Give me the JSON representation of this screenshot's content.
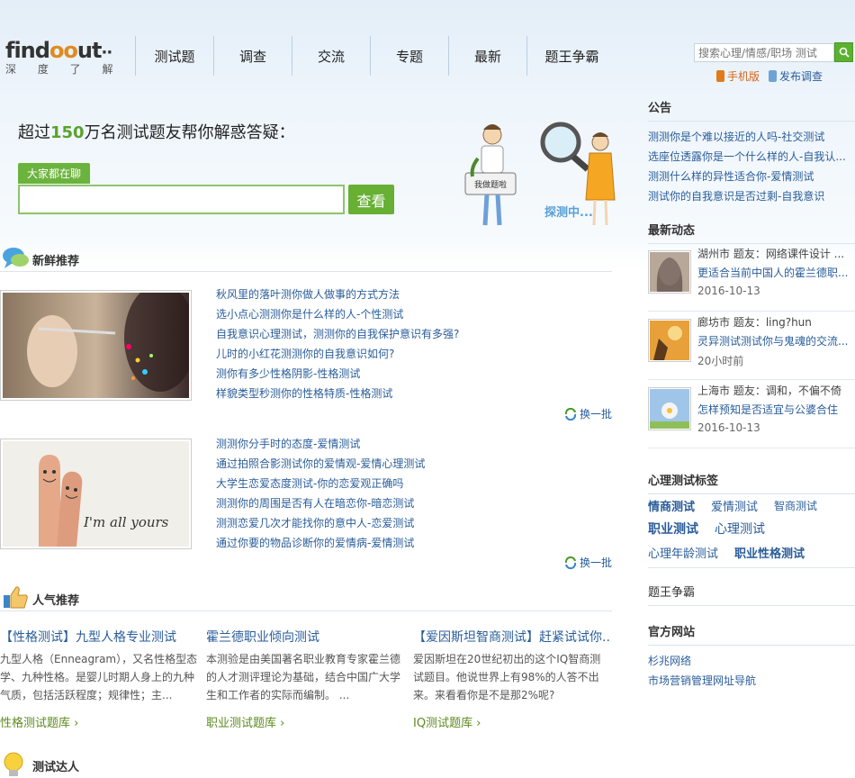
{
  "logo": {
    "text_a": "find",
    "text_oo": "oo",
    "text_b": "ut",
    "dots": "··",
    "sub": "深 度 了 解"
  },
  "nav": [
    "测试题",
    "调查",
    "交流",
    "专题",
    "最新",
    "题王争霸"
  ],
  "search": {
    "placeholder": "搜索心理/情感/职场 测试"
  },
  "top_links": {
    "mobile": "手机版",
    "publish": "发布调查"
  },
  "hero": {
    "title_pre": "超过",
    "title_num": "150",
    "title_post": "万名测试题友帮你解惑答疑：",
    "chat_tag": "大家都在聊",
    "button": "查看",
    "art_sign": "我做题啦",
    "art_text": "探测中..."
  },
  "fresh": {
    "title": "新鲜推荐",
    "group1": [
      "秋风里的落叶测你做人做事的方式方法",
      "选小点心测测你是什么样的人-个性测试",
      "自我意识心理测试，测测你的自我保护意识有多强?",
      "儿时的小红花测测你的自我意识如何?",
      "测你有多少性格阴影-性格测试",
      "样貌类型秒测你的性格特质-性格测试"
    ],
    "group2": [
      "测测你分手时的态度-爱情测试",
      "通过拍照合影测试你的爱情观-爱情心理测试",
      "大学生恋爱态度测试-你的恋爱观正确吗",
      "测测你的周围是否有人在暗恋你-暗恋测试",
      "测测恋爱几次才能找你的意中人-恋爱测试",
      "通过你要的物品诊断你的爱情病-爱情测试"
    ],
    "swap": "换一批",
    "photo2_text": "I'm all yours"
  },
  "popular": {
    "title": "人气推荐",
    "cols": [
      {
        "title": "【性格测试】九型人格专业测试",
        "desc": "九型人格（Enneagram），又名性格型态学、九种性格。是婴儿时期人身上的九种气质，包括活跃程度；规律性；主...",
        "more": "性格测试题库"
      },
      {
        "title": "霍兰德职业倾向测试",
        "desc": "本测验是由美国著名职业教育专家霍兰德的人才测评理论为基础，结合中国广大学生和工作者的实际而编制。 ...",
        "more": "职业测试题库"
      },
      {
        "title": "【爱因斯坦智商测试】赶紧试试你...",
        "desc": "爱因斯坦在20世纪初出的这个IQ智商测试题目。他说世界上有98%的人答不出来。来看看你是不是那2%呢?",
        "more": "IQ测试题库"
      }
    ]
  },
  "experts": {
    "title": "测试达人"
  },
  "sidebar": {
    "notice_title": "公告",
    "notices": [
      "测测你是个难以接近的人吗-社交测试",
      "选座位透露你是一个什么样的人-自我认...",
      "测测什么样的异性适合你-爱情测试",
      "测试你的自我意识是否过剩-自我意识"
    ],
    "feed_title": "最新动态",
    "feed": [
      {
        "line1": "湖州市  题友：网络课件设计 ...",
        "line2": "更适合当前中国人的霍兰德职...",
        "time": "2016-10-13"
      },
      {
        "line1": "廊坊市  题友：ling?hun",
        "line2": "灵异测试测试你与鬼魂的交流...",
        "time": "20小时前"
      },
      {
        "line1": "上海市  题友：调和，不偏不倚",
        "line2": "怎样预知是否适宜与公婆合住",
        "time": "2016-10-13"
      }
    ],
    "tags_title": "心理测试标签",
    "tags": [
      "情商测试",
      "爱情测试",
      "智商测试",
      "职业测试",
      "心理测试",
      "心理年龄测试",
      "职业性格测试"
    ],
    "king_title": "题王争霸",
    "official_title": "官方网站",
    "official": [
      "杉兆网络",
      "市场营销管理网址导航"
    ]
  },
  "colors": {
    "green": "#67b034",
    "link": "#2a5d9a",
    "orange": "#e08a1f"
  }
}
